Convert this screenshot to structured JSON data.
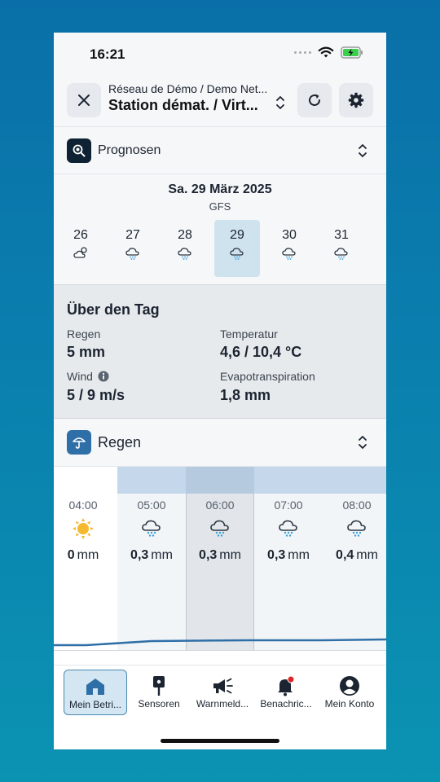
{
  "status": {
    "time": "16:21"
  },
  "header": {
    "network": "Réseau de Démo / Demo Net...",
    "station": "Station démat. / Virt..."
  },
  "forecast_section": {
    "label": "Prognosen"
  },
  "date": {
    "title": "Sa. 29 März 2025",
    "model": "GFS",
    "days": [
      {
        "num": "26",
        "icon": "cloud-sun-icon",
        "selected": false
      },
      {
        "num": "27",
        "icon": "cloud-rain-icon",
        "selected": false
      },
      {
        "num": "28",
        "icon": "cloud-rain-icon",
        "selected": false
      },
      {
        "num": "29",
        "icon": "cloud-rain-icon",
        "selected": true
      },
      {
        "num": "30",
        "icon": "cloud-rain-icon",
        "selected": false
      },
      {
        "num": "31",
        "icon": "cloud-rain-icon",
        "selected": false
      }
    ]
  },
  "summary": {
    "title": "Über den Tag",
    "rain_label": "Regen",
    "rain_value": "5 mm",
    "temp_label": "Temperatur",
    "temp_value": "4,6 / 10,4 °C",
    "wind_label": "Wind",
    "wind_value": "5 / 9 m/s",
    "evapo_label": "Evapotranspiration",
    "evapo_value": "1,8 mm"
  },
  "rain_section": {
    "label": "Regen"
  },
  "hourly": [
    {
      "time": "04:00",
      "icon": "sun-icon",
      "value": "0",
      "unit": "mm"
    },
    {
      "time": "05:00",
      "icon": "cloud-rain-icon",
      "value": "0,3",
      "unit": "mm"
    },
    {
      "time": "06:00",
      "icon": "cloud-rain-icon",
      "value": "0,3",
      "unit": "mm"
    },
    {
      "time": "07:00",
      "icon": "cloud-rain-icon",
      "value": "0,3",
      "unit": "mm"
    },
    {
      "time": "08:00",
      "icon": "cloud-rain-icon",
      "value": "0,4",
      "unit": "mm"
    }
  ],
  "nav": [
    {
      "label": "Mein Betri...",
      "icon": "home-icon",
      "active": true
    },
    {
      "label": "Sensoren",
      "icon": "sensor-icon",
      "active": false
    },
    {
      "label": "Warnmeld...",
      "icon": "megaphone-icon",
      "active": false
    },
    {
      "label": "Benachric...",
      "icon": "bell-icon",
      "active": false
    },
    {
      "label": "Mein Konto",
      "icon": "account-icon",
      "active": false
    }
  ],
  "colors": {
    "accent": "#2f6fa8",
    "rain_highlight": "#c5d7ea",
    "selected_day": "#cfe3ef",
    "sun": "#f5b82e"
  }
}
